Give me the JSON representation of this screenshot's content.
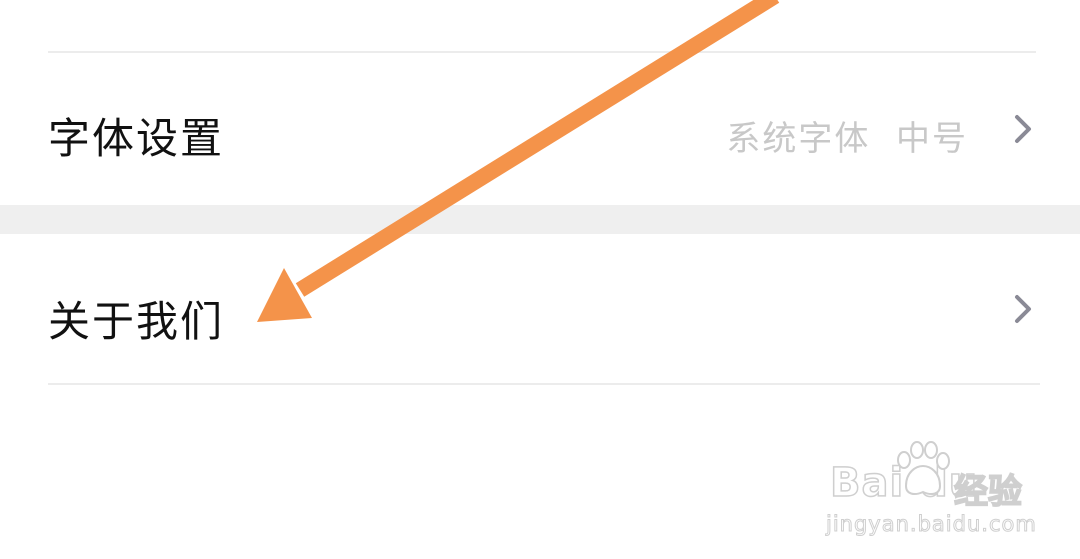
{
  "settings": {
    "font_row": {
      "label": "字体设置",
      "value": "系统字体  中号"
    },
    "about_row": {
      "label": "关于我们"
    }
  },
  "icons": {
    "chevron": "chevron-right-icon"
  },
  "annotation": {
    "arrow_color": "#f4934a"
  },
  "watermark": {
    "brand": "Bai du",
    "brand_cn": "经验",
    "url": "jingyan.baidu.com"
  },
  "colors": {
    "background": "#ffffff",
    "section_gap": "#efefef",
    "divider": "#ececec",
    "label_text": "#111111",
    "value_text": "#c8c8c8",
    "chevron": "#8a8a96"
  }
}
